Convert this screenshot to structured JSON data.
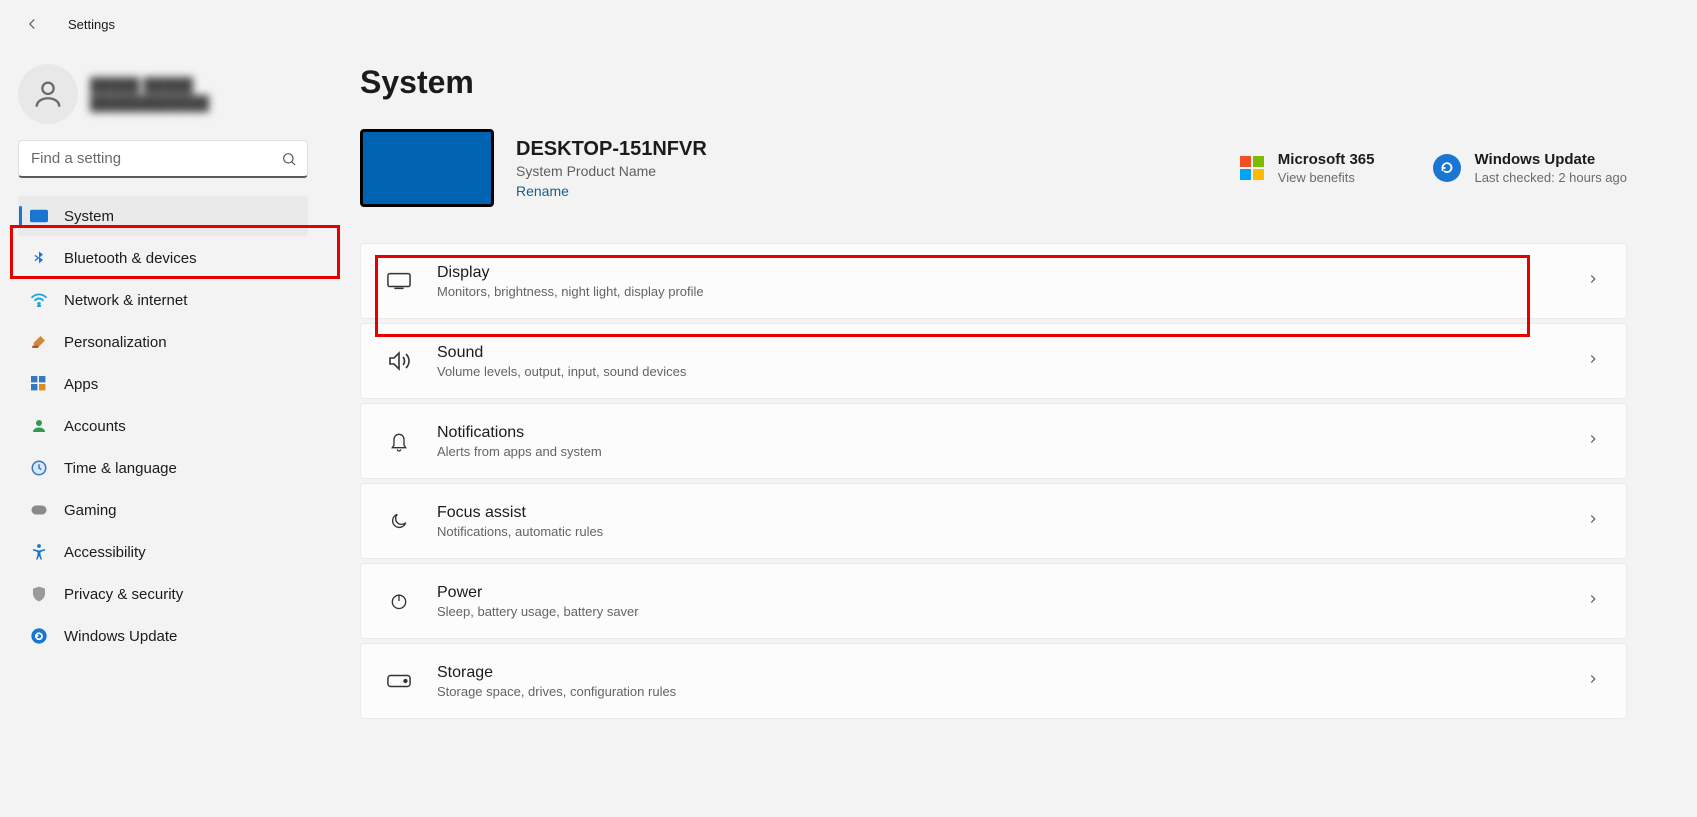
{
  "app": {
    "title": "Settings"
  },
  "search": {
    "placeholder": "Find a setting"
  },
  "profile": {
    "placeholder_name": "█████ █████",
    "placeholder_email": "████████████"
  },
  "nav": {
    "items": [
      {
        "label": "System"
      },
      {
        "label": "Bluetooth & devices"
      },
      {
        "label": "Network & internet"
      },
      {
        "label": "Personalization"
      },
      {
        "label": "Apps"
      },
      {
        "label": "Accounts"
      },
      {
        "label": "Time & language"
      },
      {
        "label": "Gaming"
      },
      {
        "label": "Accessibility"
      },
      {
        "label": "Privacy & security"
      },
      {
        "label": "Windows Update"
      }
    ]
  },
  "page": {
    "title": "System",
    "device": {
      "name": "DESKTOP-151NFVR",
      "product": "System Product Name",
      "rename": "Rename"
    },
    "ms365": {
      "title": "Microsoft 365",
      "sub": "View benefits"
    },
    "wu": {
      "title": "Windows Update",
      "sub": "Last checked: 2 hours ago"
    },
    "cards": [
      {
        "title": "Display",
        "sub": "Monitors, brightness, night light, display profile"
      },
      {
        "title": "Sound",
        "sub": "Volume levels, output, input, sound devices"
      },
      {
        "title": "Notifications",
        "sub": "Alerts from apps and system"
      },
      {
        "title": "Focus assist",
        "sub": "Notifications, automatic rules"
      },
      {
        "title": "Power",
        "sub": "Sleep, battery usage, battery saver"
      },
      {
        "title": "Storage",
        "sub": "Storage space, drives, configuration rules"
      }
    ]
  }
}
